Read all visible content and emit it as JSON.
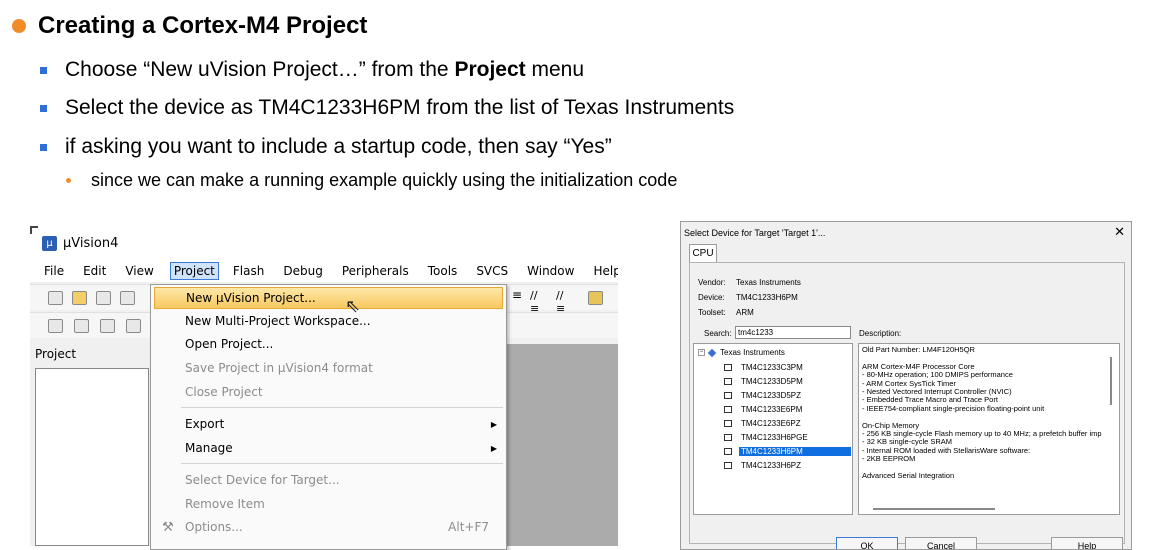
{
  "slide": {
    "heading": "Creating a Cortex-M4 Project",
    "bullets": [
      {
        "pre": "Choose “New uVision Project…” from the ",
        "bold": "Project",
        "post": " menu"
      },
      {
        "text": "Select the device as TM4C1233H6PM from the list of Texas Instruments"
      },
      {
        "text": "if asking you want to include a startup code, then say “Yes”"
      }
    ],
    "subbullet": "since we can make a running example quickly using the initialization code",
    "colors": {
      "bullet_dot": "#f28c28",
      "bullet_square": "#2e6fd6"
    }
  },
  "uvision": {
    "title": "µVision4",
    "app_icon": "uvision-logo-icon",
    "menubar": [
      "File",
      "Edit",
      "View",
      "Project",
      "Flash",
      "Debug",
      "Peripherals",
      "Tools",
      "SVCS",
      "Window",
      "Help"
    ],
    "active_menu": "Project",
    "project_pane_label": "Project",
    "project_menu": {
      "new_project": "New µVision Project...",
      "new_multi": "New Multi-Project Workspace...",
      "open": "Open Project...",
      "save_v4": "Save Project in µVision4 format",
      "close": "Close Project",
      "export": "Export",
      "manage": "Manage",
      "select_device": "Select Device for Target...",
      "remove_item": "Remove Item",
      "options": "Options...",
      "options_shortcut": "Alt+F7"
    }
  },
  "device_dialog": {
    "title": "Select Device for Target 'Target 1'...",
    "tab": "CPU",
    "vendor_label": "Vendor:",
    "vendor": "Texas Instruments",
    "device_label": "Device:",
    "device": "TM4C1233H6PM",
    "toolset_label": "Toolset:",
    "toolset": "ARM",
    "search_label": "Search:",
    "search_value": "tm4c1233",
    "description_label": "Description:",
    "tree_root": "Texas Instruments",
    "devices": [
      "TM4C1233C3PM",
      "TM4C1233D5PM",
      "TM4C1233D5PZ",
      "TM4C1233E6PM",
      "TM4C1233E6PZ",
      "TM4C1233H6PGE",
      "TM4C1233H6PM",
      "TM4C1233H6PZ"
    ],
    "selected_device": "TM4C1233H6PM",
    "description": "Old Part Number: LM4F120H5QR\n\nARM Cortex-M4F Processor Core\n- 80-MHz operation; 100 DMIPS performance\n- ARM Cortex SysTick Timer\n- Nested Vectored Interrupt Controller (NVIC)\n- Embedded Trace Macro and Trace Port\n- IEEE754-compliant single-precision floating-point unit\n\nOn-Chip Memory\n- 256 KB single-cycle Flash memory up to 40 MHz; a prefetch buffer imp\n- 32 KB single-cycle SRAM\n- Internal ROM loaded with StellarisWare software:\n- 2KB EEPROM\n\nAdvanced Serial Integration",
    "ok": "OK",
    "cancel": "Cancel",
    "help": "Help"
  }
}
